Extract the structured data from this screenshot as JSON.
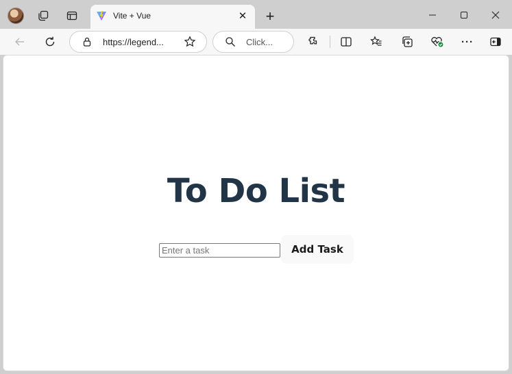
{
  "browser": {
    "tab": {
      "title": "Vite + Vue"
    },
    "address_bar": {
      "url": "https://legend..."
    },
    "search_box": {
      "placeholder": "Click..."
    },
    "new_tab_symbol": "+",
    "close_symbol": "✕",
    "more_symbol": "···"
  },
  "page": {
    "heading": "To Do List",
    "task_input": {
      "value": "",
      "placeholder": "Enter a task"
    },
    "add_button_label": "Add Task"
  },
  "colors": {
    "heading": "#213547",
    "tab_active": "#f7f7f7",
    "chrome_bg": "#cfcfcf"
  }
}
